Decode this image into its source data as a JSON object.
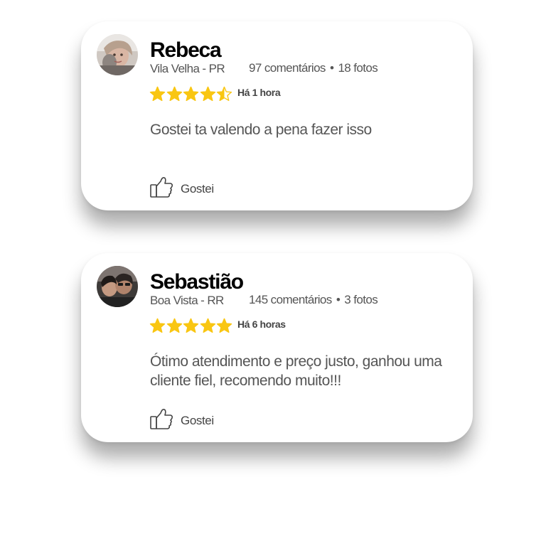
{
  "colors": {
    "star": "#F9C612",
    "name": "#000000",
    "meta": "#555555"
  },
  "reviews": [
    {
      "name": "Rebeca",
      "location": "Vila Velha - PR",
      "comments": "97 comentários",
      "separator": "•",
      "photos": "18 fotos",
      "rating": 4.5,
      "time": "Há 1 hora",
      "text": "Gostei ta valendo a pena fazer isso",
      "like_label": "Gostei",
      "like_icon": "thumbs-up-icon",
      "avatar_icon": "user-photo-avatar"
    },
    {
      "name": "Sebastião",
      "location": "Boa Vista - RR",
      "comments": "145 comentários",
      "separator": "•",
      "photos": "3 fotos",
      "rating": 5,
      "time": "Há 6 horas",
      "text": "Ótimo atendimento e preço justo, ganhou uma cliente fiel, recomendo muito!!!",
      "like_label": "Gostei",
      "like_icon": "thumbs-up-icon",
      "avatar_icon": "user-photo-avatar"
    }
  ]
}
